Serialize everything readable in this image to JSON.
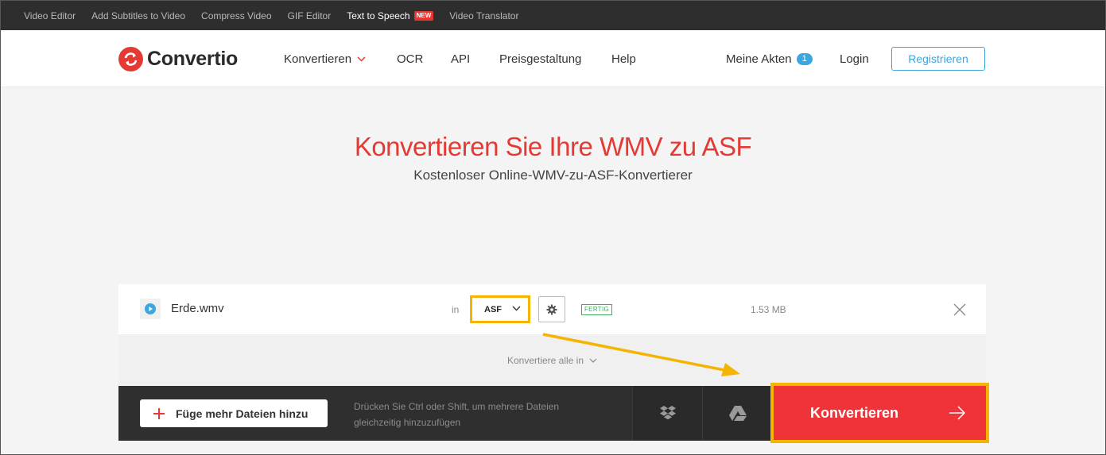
{
  "topbar": {
    "links": [
      {
        "label": "Video Editor"
      },
      {
        "label": "Add Subtitles to Video"
      },
      {
        "label": "Compress Video"
      },
      {
        "label": "GIF Editor"
      },
      {
        "label": "Text to Speech",
        "badge": "NEW"
      },
      {
        "label": "Video Translator"
      }
    ]
  },
  "header": {
    "logo_text": "Convertio",
    "nav": {
      "convert": "Konvertieren",
      "ocr": "OCR",
      "api": "API",
      "pricing": "Preisgestaltung",
      "help": "Help"
    },
    "my_files": "Meine Akten",
    "my_files_count": "1",
    "login": "Login",
    "register": "Registrieren"
  },
  "hero": {
    "title": "Konvertieren Sie Ihre WMV zu ASF",
    "subtitle": "Kostenloser Online-WMV-zu-ASF-Konvertierer"
  },
  "file": {
    "name": "Erde.wmv",
    "in_label": "in",
    "target_format": "ASF",
    "status": "FERTIG",
    "size": "1.53 MB"
  },
  "convert_all_label": "Konvertiere alle in",
  "bottom": {
    "add_files": "Füge mehr Dateien hinzu",
    "hint": "Drücken Sie Ctrl oder Shift, um mehrere Dateien gleichzeitig hinzuzufügen",
    "convert": "Konvertieren"
  },
  "colors": {
    "brand_red": "#e53a34",
    "accent_blue": "#3aa7e0",
    "highlight": "#f5b400",
    "status_green": "#3cb060"
  },
  "icons": [
    "convertio-logo-icon",
    "chevron-down-icon",
    "play-icon",
    "gear-icon",
    "close-icon",
    "plus-icon",
    "dropbox-icon",
    "google-drive-icon",
    "arrow-right-icon"
  ]
}
